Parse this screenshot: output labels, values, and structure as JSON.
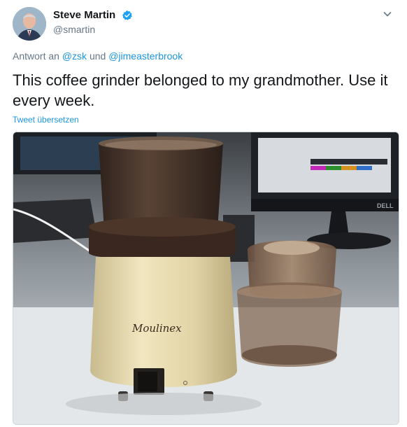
{
  "tweet": {
    "author": {
      "display_name": "Steve Martin",
      "handle": "@smartin",
      "verified": true,
      "avatar_icon": "user-avatar-photo"
    },
    "menu_icon": "chevron-down-icon",
    "reply_prefix": "Antwort an",
    "reply_mentions": [
      "@zsk",
      "@jimeasterbrook"
    ],
    "reply_joiner": "und",
    "text": "This coffee grinder belonged to my grandmother. Use it every week.",
    "translate_label": "Tweet übersetzen",
    "media": {
      "description_icon": "photo-coffee-grinder",
      "brand_text": "Moulinex",
      "monitor_brand": "DELL"
    }
  },
  "colors": {
    "link": "#1b95e0",
    "secondary": "#657786",
    "verified": "#1da1f2"
  }
}
